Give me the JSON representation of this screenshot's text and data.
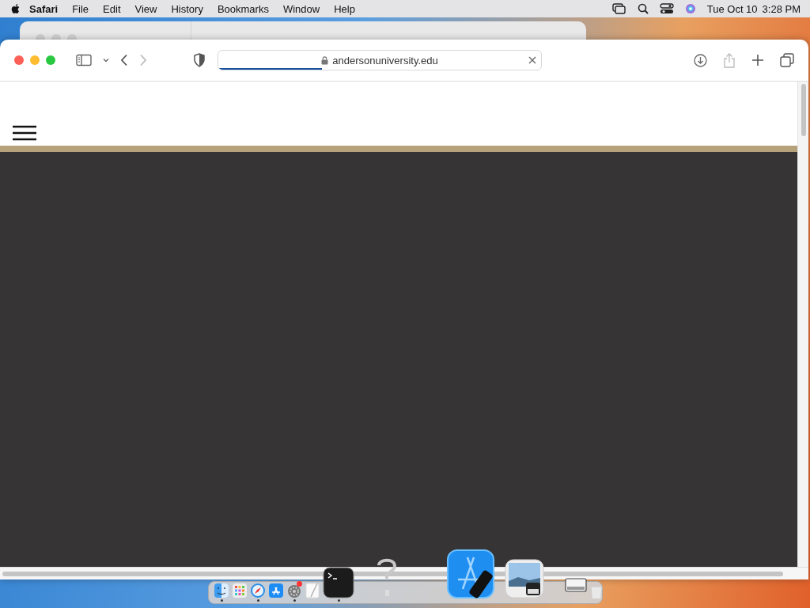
{
  "menubar": {
    "menus": [
      {
        "label": "Safari",
        "kind": "app"
      },
      {
        "label": "File",
        "kind": "menu"
      },
      {
        "label": "Edit",
        "kind": "menu"
      },
      {
        "label": "View",
        "kind": "menu"
      },
      {
        "label": "History",
        "kind": "menu"
      },
      {
        "label": "Bookmarks",
        "kind": "menu"
      },
      {
        "label": "Window",
        "kind": "menu"
      },
      {
        "label": "Help",
        "kind": "menu"
      }
    ],
    "date": "Tue Oct 10",
    "time": "3:28 PM"
  },
  "browser": {
    "url": "andersonuniversity.edu",
    "level": 0.32
  },
  "dock": {
    "items": [
      {
        "kind": "finder",
        "running": true
      },
      {
        "kind": "launchpad",
        "running": false
      },
      {
        "kind": "safari",
        "running": true
      },
      {
        "kind": "appstore",
        "running": false
      },
      {
        "kind": "settings",
        "running": true,
        "badge": true
      },
      {
        "kind": "textedit",
        "running": false
      },
      {
        "kind": "terminal",
        "running": true
      },
      {
        "kind": "unknown",
        "running": false
      },
      {
        "kind": "separator"
      },
      {
        "kind": "xcode",
        "running": false
      },
      {
        "kind": "preview",
        "running": false
      },
      {
        "kind": "separator"
      },
      {
        "kind": "desktop",
        "running": false
      },
      {
        "kind": "trash",
        "running": false
      }
    ]
  }
}
